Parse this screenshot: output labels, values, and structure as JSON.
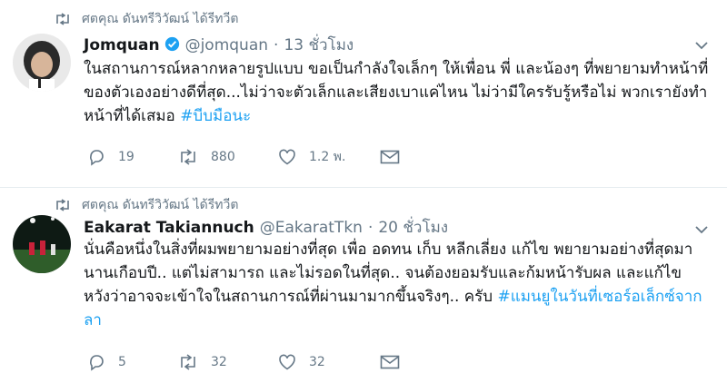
{
  "tweets": [
    {
      "retweet_notice": "ศตคุณ ดันทรีวิวัฒน์ ได้รีทวีต",
      "name": "Jomquan",
      "handle": "@jomquan",
      "separator": "·",
      "time": "13 ชั่วโมง",
      "text": "ในสถานการณ์หลากหลายรูปแบบ ขอเป็นกำลังใจเล็กๆ ให้เพื่อน พี่ และน้องๆ ที่พยายามทำหน้าที่ของตัวเองอย่างดีที่สุด...ไม่ว่าจะตัวเล็กและเสียงเบาแค่ไหน ไม่ว่ามีใครรับรู้หรือไม่ พวกเรายังทำหน้าที่ได้เสมอ ",
      "hashtag": "#บีบมือนะ",
      "replies": "19",
      "retweets": "880",
      "likes": "1.2 พ.",
      "verified": true
    },
    {
      "retweet_notice": "ศตคุณ ดันทรีวิวัฒน์ ได้รีทวีต",
      "name": "Eakarat Takiannuch",
      "handle": "@EakaratTkn",
      "separator": "·",
      "time": "20 ชั่วโมง",
      "text": "นั่นคือหนึ่งในสิ่งที่ผมพยายามอย่างที่สุด เพื่อ อดทน เก็บ หลีกเลี่ยง แก้ไข พยายามอย่างที่สุดมานานเกือบปี.. แต่ไม่สามารถ และไม่รอดในที่สุด.. จนต้องยอมรับและก้มหน้ารับผล และแก้ไข หวังว่าอาจจะเข้าใจในสถานการณ์ที่ผ่านมามากขึ้นจริงๆ.. ครับ ",
      "hashtag": "#แมนยูในวันที่เซอร์อเล็กซ์จากลา",
      "replies": "5",
      "retweets": "32",
      "likes": "32",
      "verified": false
    }
  ],
  "colors": {
    "text": "#14171a",
    "secondary": "#657786",
    "link": "#1da1f2",
    "verified": "#1da1f2",
    "divider": "#e6ecf0"
  },
  "icons": [
    "retweet-icon",
    "verified-badge-icon",
    "chevron-down-icon",
    "reply-icon",
    "like-icon",
    "message-icon"
  ]
}
